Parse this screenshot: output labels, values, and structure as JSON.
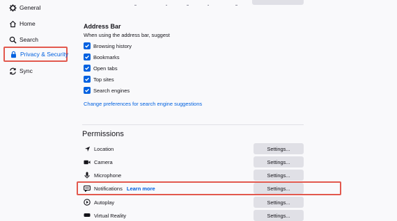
{
  "sidebar": {
    "items": [
      {
        "label": "General",
        "icon": "gear-icon"
      },
      {
        "label": "Home",
        "icon": "home-icon"
      },
      {
        "label": "Search",
        "icon": "search-icon"
      },
      {
        "label": "Privacy & Security",
        "icon": "lock-icon",
        "active": true
      },
      {
        "label": "Sync",
        "icon": "sync-icon"
      }
    ]
  },
  "address_bar": {
    "heading": "Address Bar",
    "subtitle": "When using the address bar, suggest",
    "options": [
      {
        "label": "Browsing history",
        "checked": true
      },
      {
        "label": "Bookmarks",
        "checked": true
      },
      {
        "label": "Open tabs",
        "checked": true
      },
      {
        "label": "Top sites",
        "checked": true
      },
      {
        "label": "Search engines",
        "checked": true
      }
    ],
    "link": "Change preferences for search engine suggestions"
  },
  "permissions": {
    "heading": "Permissions",
    "rows": [
      {
        "label": "Location",
        "icon": "location-arrow-icon",
        "button": "Settings..."
      },
      {
        "label": "Camera",
        "icon": "camera-icon",
        "button": "Settings..."
      },
      {
        "label": "Microphone",
        "icon": "microphone-icon",
        "button": "Settings..."
      },
      {
        "label": "Notifications",
        "icon": "notification-icon",
        "learn_more": "Learn more",
        "button": "Settings..."
      },
      {
        "label": "Autoplay",
        "icon": "autoplay-icon",
        "button": "Settings..."
      },
      {
        "label": "Virtual Reality",
        "icon": "vr-icon",
        "button": "Settings..."
      }
    ]
  },
  "colors": {
    "accent": "#0061e0",
    "highlight": "#e2584d",
    "button_bg": "#e0e0e6",
    "background": "#f9f9fb"
  }
}
